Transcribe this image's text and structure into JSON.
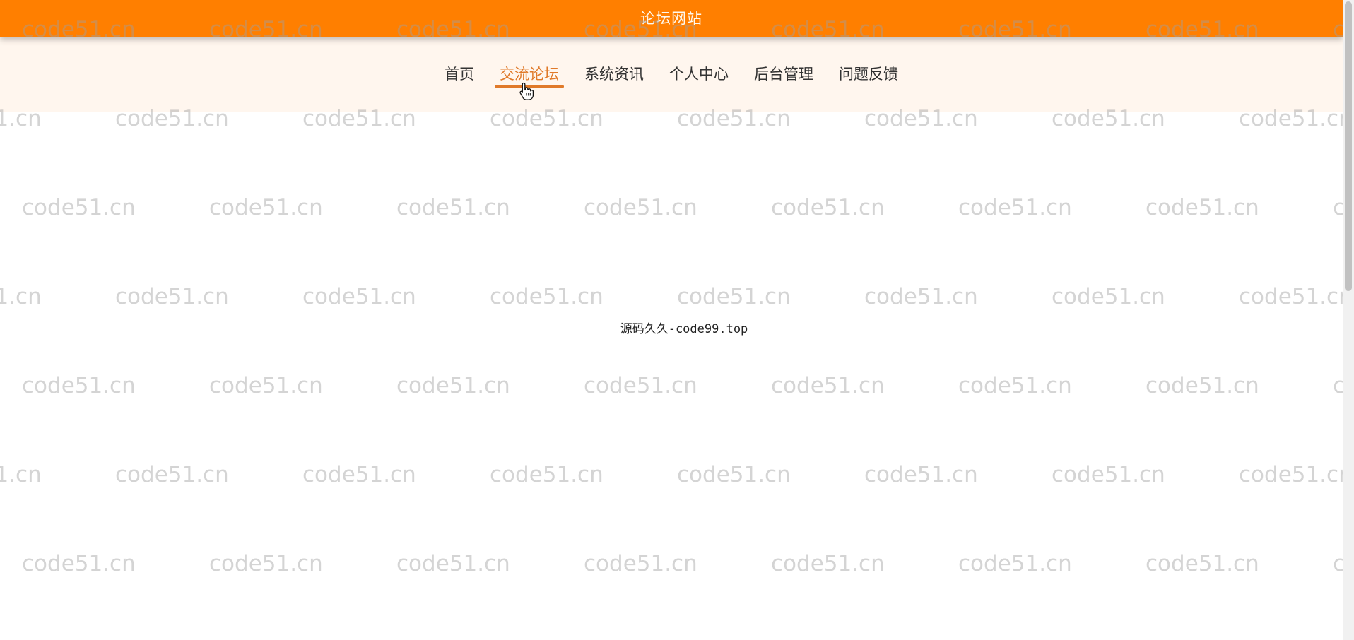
{
  "header": {
    "site_title": "论坛网站",
    "bar_color": "#ff7f00"
  },
  "nav": {
    "items": [
      {
        "label": "首页",
        "active": false
      },
      {
        "label": "交流论坛",
        "active": true
      },
      {
        "label": "系统资讯",
        "active": false
      },
      {
        "label": "个人中心",
        "active": false
      },
      {
        "label": "后台管理",
        "active": false
      },
      {
        "label": "问题反馈",
        "active": false
      }
    ],
    "active_color": "#e07a2a",
    "background": "#fff6ee"
  },
  "main": {
    "footer_text": "源码久久-code99.top"
  },
  "watermark": {
    "text": "code51.cn"
  },
  "icons": {
    "cursor": "hand-pointer-icon"
  }
}
